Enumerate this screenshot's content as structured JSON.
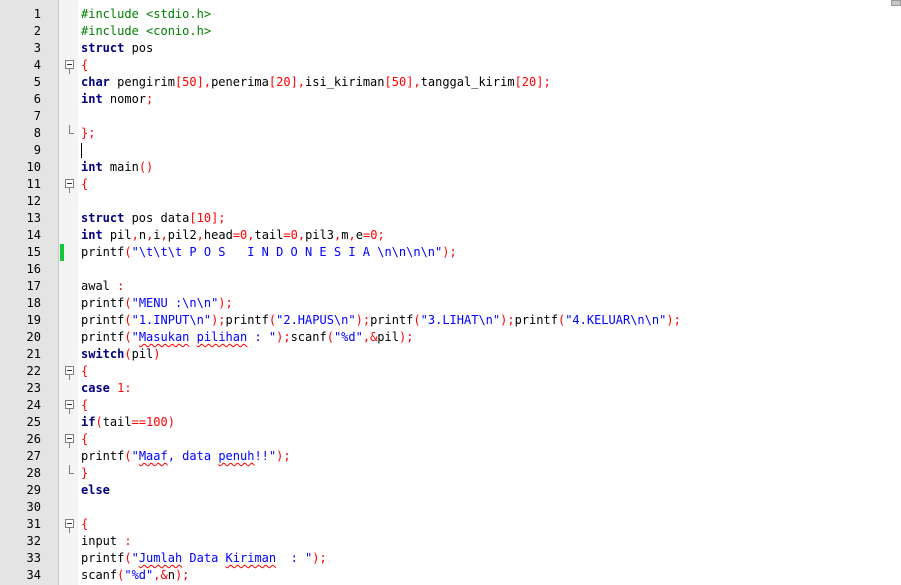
{
  "editor": {
    "lines": [
      {
        "n": "1",
        "fold": "",
        "tokens": [
          {
            "t": "pp",
            "v": "#include <stdio.h>"
          }
        ]
      },
      {
        "n": "2",
        "fold": "",
        "tokens": [
          {
            "t": "pp",
            "v": "#include <conio.h>"
          }
        ]
      },
      {
        "n": "3",
        "fold": "",
        "tokens": [
          {
            "t": "kw",
            "v": "struct"
          },
          {
            "t": "tx",
            "v": " pos"
          }
        ]
      },
      {
        "n": "4",
        "fold": "open",
        "tokens": [
          {
            "t": "op",
            "v": "{"
          }
        ]
      },
      {
        "n": "5",
        "fold": "",
        "tokens": [
          {
            "t": "kw",
            "v": "char"
          },
          {
            "t": "tx",
            "v": " pengirim"
          },
          {
            "t": "op",
            "v": "["
          },
          {
            "t": "num",
            "v": "50"
          },
          {
            "t": "op",
            "v": "],"
          },
          {
            "t": "tx",
            "v": "penerima"
          },
          {
            "t": "op",
            "v": "["
          },
          {
            "t": "num",
            "v": "20"
          },
          {
            "t": "op",
            "v": "],"
          },
          {
            "t": "tx",
            "v": "isi_kiriman"
          },
          {
            "t": "op",
            "v": "["
          },
          {
            "t": "num",
            "v": "50"
          },
          {
            "t": "op",
            "v": "],"
          },
          {
            "t": "tx",
            "v": "tanggal_kirim"
          },
          {
            "t": "op",
            "v": "["
          },
          {
            "t": "num",
            "v": "20"
          },
          {
            "t": "op",
            "v": "];"
          }
        ]
      },
      {
        "n": "6",
        "fold": "",
        "tokens": [
          {
            "t": "kw",
            "v": "int"
          },
          {
            "t": "tx",
            "v": " nomor"
          },
          {
            "t": "op",
            "v": ";"
          }
        ]
      },
      {
        "n": "7",
        "fold": "",
        "tokens": []
      },
      {
        "n": "8",
        "fold": "end",
        "tokens": [
          {
            "t": "op",
            "v": "};"
          }
        ]
      },
      {
        "n": "9",
        "fold": "",
        "tokens": [],
        "caret": true
      },
      {
        "n": "10",
        "fold": "",
        "tokens": [
          {
            "t": "kw",
            "v": "int"
          },
          {
            "t": "tx",
            "v": " main"
          },
          {
            "t": "op",
            "v": "()"
          }
        ]
      },
      {
        "n": "11",
        "fold": "open",
        "tokens": [
          {
            "t": "op",
            "v": "{"
          }
        ]
      },
      {
        "n": "12",
        "fold": "",
        "tokens": []
      },
      {
        "n": "13",
        "fold": "",
        "tokens": [
          {
            "t": "kw",
            "v": "struct"
          },
          {
            "t": "tx",
            "v": " pos data"
          },
          {
            "t": "op",
            "v": "["
          },
          {
            "t": "num",
            "v": "10"
          },
          {
            "t": "op",
            "v": "];"
          }
        ]
      },
      {
        "n": "14",
        "fold": "",
        "tokens": [
          {
            "t": "kw",
            "v": "int"
          },
          {
            "t": "tx",
            "v": " pil"
          },
          {
            "t": "op",
            "v": ","
          },
          {
            "t": "tx",
            "v": "n"
          },
          {
            "t": "op",
            "v": ","
          },
          {
            "t": "tx",
            "v": "i"
          },
          {
            "t": "op",
            "v": ","
          },
          {
            "t": "tx",
            "v": "pil2"
          },
          {
            "t": "op",
            "v": ","
          },
          {
            "t": "tx",
            "v": "head"
          },
          {
            "t": "op",
            "v": "="
          },
          {
            "t": "num",
            "v": "0"
          },
          {
            "t": "op",
            "v": ","
          },
          {
            "t": "tx",
            "v": "tail"
          },
          {
            "t": "op",
            "v": "="
          },
          {
            "t": "num",
            "v": "0"
          },
          {
            "t": "op",
            "v": ","
          },
          {
            "t": "tx",
            "v": "pil3"
          },
          {
            "t": "op",
            "v": ","
          },
          {
            "t": "tx",
            "v": "m"
          },
          {
            "t": "op",
            "v": ","
          },
          {
            "t": "tx",
            "v": "e"
          },
          {
            "t": "op",
            "v": "="
          },
          {
            "t": "num",
            "v": "0"
          },
          {
            "t": "op",
            "v": ";"
          }
        ]
      },
      {
        "n": "15",
        "fold": "",
        "saved": true,
        "tokens": [
          {
            "t": "tx",
            "v": "printf"
          },
          {
            "t": "op",
            "v": "("
          },
          {
            "t": "str",
            "v": "\"\\t\\t\\t P O S   I N D O N E S I A \\n\\n\\n\\n\""
          },
          {
            "t": "op",
            "v": ");"
          }
        ]
      },
      {
        "n": "16",
        "fold": "",
        "tokens": []
      },
      {
        "n": "17",
        "fold": "",
        "tokens": [
          {
            "t": "tx",
            "v": "awal "
          },
          {
            "t": "op",
            "v": ":"
          }
        ]
      },
      {
        "n": "18",
        "fold": "",
        "tokens": [
          {
            "t": "tx",
            "v": "printf"
          },
          {
            "t": "op",
            "v": "("
          },
          {
            "t": "str",
            "v": "\"MENU :\\n\\n\""
          },
          {
            "t": "op",
            "v": ");"
          }
        ]
      },
      {
        "n": "19",
        "fold": "",
        "tokens": [
          {
            "t": "tx",
            "v": "printf"
          },
          {
            "t": "op",
            "v": "("
          },
          {
            "t": "str",
            "v": "\"1.INPUT\\n\""
          },
          {
            "t": "op",
            "v": ");"
          },
          {
            "t": "tx",
            "v": "printf"
          },
          {
            "t": "op",
            "v": "("
          },
          {
            "t": "str",
            "v": "\"2.HAPUS\\n\""
          },
          {
            "t": "op",
            "v": ");"
          },
          {
            "t": "tx",
            "v": "printf"
          },
          {
            "t": "op",
            "v": "("
          },
          {
            "t": "str",
            "v": "\"3.LIHAT\\n\""
          },
          {
            "t": "op",
            "v": ");"
          },
          {
            "t": "tx",
            "v": "printf"
          },
          {
            "t": "op",
            "v": "("
          },
          {
            "t": "str",
            "v": "\"4.KELUAR\\n\\n\""
          },
          {
            "t": "op",
            "v": ");"
          }
        ]
      },
      {
        "n": "20",
        "fold": "",
        "tokens": [
          {
            "t": "tx",
            "v": "printf"
          },
          {
            "t": "op",
            "v": "("
          },
          {
            "t": "str",
            "v": "\""
          },
          {
            "t": "strsq",
            "v": "Masukan"
          },
          {
            "t": "str",
            "v": " "
          },
          {
            "t": "strsq",
            "v": "pilihan"
          },
          {
            "t": "str",
            "v": " : \""
          },
          {
            "t": "op",
            "v": ");"
          },
          {
            "t": "tx",
            "v": "scanf"
          },
          {
            "t": "op",
            "v": "("
          },
          {
            "t": "str",
            "v": "\"%d\""
          },
          {
            "t": "op",
            "v": ",&"
          },
          {
            "t": "tx",
            "v": "pil"
          },
          {
            "t": "op",
            "v": ");"
          }
        ]
      },
      {
        "n": "21",
        "fold": "",
        "tokens": [
          {
            "t": "kw",
            "v": "switch"
          },
          {
            "t": "op",
            "v": "("
          },
          {
            "t": "tx",
            "v": "pil"
          },
          {
            "t": "op",
            "v": ")"
          }
        ]
      },
      {
        "n": "22",
        "fold": "open",
        "tokens": [
          {
            "t": "op",
            "v": "{"
          }
        ]
      },
      {
        "n": "23",
        "fold": "",
        "tokens": [
          {
            "t": "kw",
            "v": "case"
          },
          {
            "t": "tx",
            "v": " "
          },
          {
            "t": "num",
            "v": "1"
          },
          {
            "t": "op",
            "v": ":"
          }
        ]
      },
      {
        "n": "24",
        "fold": "open",
        "tokens": [
          {
            "t": "op",
            "v": "{"
          }
        ]
      },
      {
        "n": "25",
        "fold": "",
        "tokens": [
          {
            "t": "kw",
            "v": "if"
          },
          {
            "t": "op",
            "v": "("
          },
          {
            "t": "tx",
            "v": "tail"
          },
          {
            "t": "op",
            "v": "=="
          },
          {
            "t": "num",
            "v": "100"
          },
          {
            "t": "op",
            "v": ")"
          }
        ]
      },
      {
        "n": "26",
        "fold": "open",
        "tokens": [
          {
            "t": "op",
            "v": "{"
          }
        ]
      },
      {
        "n": "27",
        "fold": "",
        "tokens": [
          {
            "t": "tx",
            "v": "printf"
          },
          {
            "t": "op",
            "v": "("
          },
          {
            "t": "str",
            "v": "\""
          },
          {
            "t": "strsq",
            "v": "Maaf"
          },
          {
            "t": "str",
            "v": ", data "
          },
          {
            "t": "strsq",
            "v": "penuh"
          },
          {
            "t": "str",
            "v": "!!\""
          },
          {
            "t": "op",
            "v": ");"
          }
        ]
      },
      {
        "n": "28",
        "fold": "end",
        "tokens": [
          {
            "t": "op",
            "v": "}"
          }
        ]
      },
      {
        "n": "29",
        "fold": "",
        "tokens": [
          {
            "t": "kw",
            "v": "else"
          }
        ]
      },
      {
        "n": "30",
        "fold": "",
        "tokens": []
      },
      {
        "n": "31",
        "fold": "open",
        "tokens": [
          {
            "t": "op",
            "v": "{"
          }
        ]
      },
      {
        "n": "32",
        "fold": "",
        "tokens": [
          {
            "t": "tx",
            "v": "input "
          },
          {
            "t": "op",
            "v": ":"
          }
        ]
      },
      {
        "n": "33",
        "fold": "",
        "tokens": [
          {
            "t": "tx",
            "v": "printf"
          },
          {
            "t": "op",
            "v": "("
          },
          {
            "t": "str",
            "v": "\""
          },
          {
            "t": "strsq",
            "v": "Jumlah"
          },
          {
            "t": "str",
            "v": " Data "
          },
          {
            "t": "strsq",
            "v": "Kiriman"
          },
          {
            "t": "str",
            "v": "  : \""
          },
          {
            "t": "op",
            "v": ");"
          }
        ]
      },
      {
        "n": "34",
        "fold": "",
        "tokens": [
          {
            "t": "tx",
            "v": "scanf"
          },
          {
            "t": "op",
            "v": "("
          },
          {
            "t": "str",
            "v": "\"%d\""
          },
          {
            "t": "op",
            "v": ",&"
          },
          {
            "t": "tx",
            "v": "n"
          },
          {
            "t": "op",
            "v": ");"
          }
        ]
      }
    ]
  }
}
